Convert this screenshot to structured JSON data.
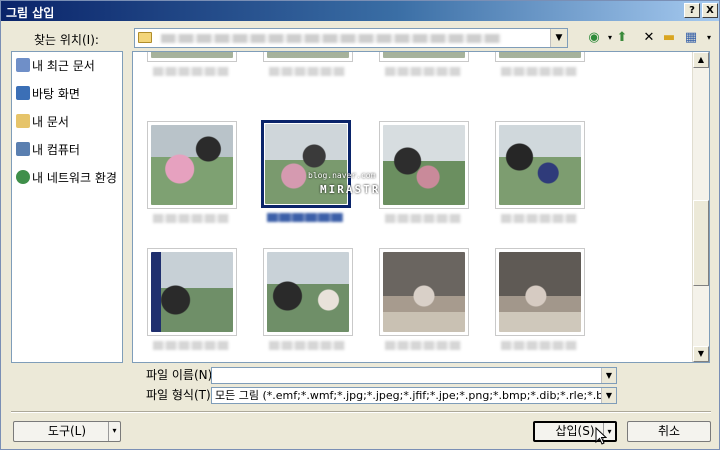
{
  "window": {
    "title": "그림 삽입",
    "help_label": "?",
    "close_label": "X"
  },
  "toolbar": {
    "look_in_label": "찾는 위치(I):",
    "back_icon": "back-arrow-icon",
    "up_icon": "up-folder-icon",
    "delete_icon": "delete-icon",
    "new_folder_icon": "new-folder-icon",
    "views_icon": "views-icon"
  },
  "places": [
    {
      "label": "내 최근 문서",
      "icon": "recent-docs-icon",
      "color": "#6f8fc8"
    },
    {
      "label": "바탕 화면",
      "icon": "desktop-icon",
      "color": "#3b6fb6"
    },
    {
      "label": "내 문서",
      "icon": "my-documents-icon",
      "color": "#e6c46a"
    },
    {
      "label": "내 컴퓨터",
      "icon": "my-computer-icon",
      "color": "#5a7fb0"
    },
    {
      "label": "내 네트워크 환경",
      "icon": "network-places-icon",
      "color": "#3f8f4a"
    }
  ],
  "thumbnails": {
    "selected_index": 3,
    "watermark": "blog.naver.com",
    "watermark_sub": "MIRASTRO"
  },
  "filename": {
    "label": "파일 이름(N):",
    "value": ""
  },
  "filetype": {
    "label": "파일 형식(T):",
    "value": "모든 그림 (*.emf;*.wmf;*.jpg;*.jpeg;*.jfif;*.jpe;*.png;*.bmp;*.dib;*.rle;*.bm"
  },
  "buttons": {
    "tools": "도구(L)",
    "insert": "삽입(S)",
    "cancel": "취소"
  },
  "colors": {
    "titlebar": "#0a246a",
    "selection": "#0a246a",
    "dialog_bg": "#ece9d8"
  }
}
